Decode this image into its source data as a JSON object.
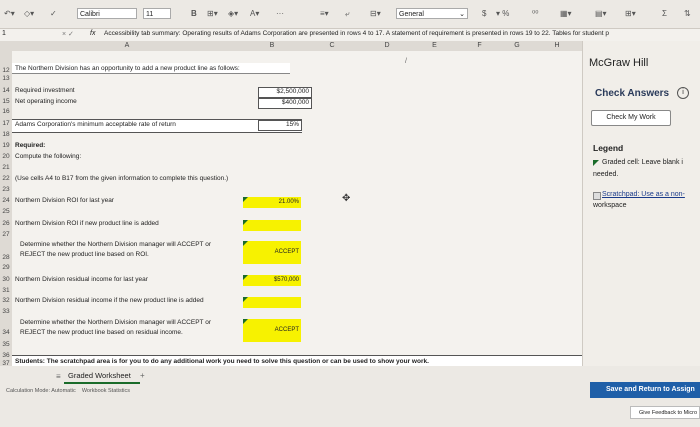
{
  "toolbar": {
    "font_name": "Calibri",
    "font_size": "11",
    "number_format": "General",
    "bold_label": "B",
    "more_label": "···",
    "sum_label": "Σ",
    "currency_label": "$"
  },
  "formula_bar": {
    "cell_ref": "1",
    "fx": "fx",
    "content": "Accessibility tab summary: Operating results of Adams Corporation are presented in rows 4 to 17. A statement of requirement is presented in rows 19 to 22. Tables for student p"
  },
  "columns": [
    "A",
    "B",
    "C",
    "D",
    "E",
    "F",
    "G",
    "H"
  ],
  "rows": [
    "12",
    "13",
    "14",
    "15",
    "16",
    "17",
    "18",
    "19",
    "20",
    "21",
    "22",
    "23",
    "24",
    "25",
    "26",
    "27",
    "28",
    "29",
    "30",
    "31",
    "32",
    "33",
    "34",
    "35",
    "36",
    "37",
    "38"
  ],
  "sheet": {
    "r12": "The Northern Division has an opportunity to add a new product line as follows:",
    "r14_label": "Required investment",
    "r14_value": "$2,500,000",
    "r15_label": "Net operating income",
    "r15_value": "$400,000",
    "r17_label": "Adams Corporation's minimum acceptable rate of return",
    "r17_value": "15%",
    "r19": "Required:",
    "r20": "Compute the following:",
    "r22": "(Use cells A4 to B17 from the given information to complete this question.)",
    "r24_label": "Northern Division ROI for last year",
    "r24_value": "21.00%",
    "r26_label": "Northern Division ROI if new product line is added",
    "r28a": "Determine whether the Northern Division manager will ACCEPT or",
    "r28b": "REJECT the new product line based on ROI.",
    "r28_value": "ACCEPT",
    "r30_label": "Northern Division residual income for last year",
    "r30_value": "$570,000",
    "r32_label": "Northern Division residual income if the new product line is added",
    "r34a": "Determine whether the Northern Division manager will ACCEPT or",
    "r34b": "REJECT the new product line based on residual income.",
    "r34_value": "ACCEPT",
    "r38": "Students: The scratchpad area is for you to do any additional work you need to solve this question or can be used to show your work."
  },
  "sidebar": {
    "brand": "McGraw Hill",
    "check_answers": "Check Answers",
    "check_my_work": "Check My Work",
    "legend_title": "Legend",
    "legend_graded": "Graded cell: Leave blank i",
    "legend_graded2": "needed.",
    "legend_scratch": "Scratchpad: Use as a non-",
    "legend_scratch2": "workspace"
  },
  "bottom": {
    "sheet_tab": "Graded Worksheet",
    "add_tab": "+",
    "status": "Calculation Mode: Automatic    Workbook Statistics",
    "save_button": "Save and Return to Assign",
    "feedback": "Give Feedback to Micro"
  }
}
